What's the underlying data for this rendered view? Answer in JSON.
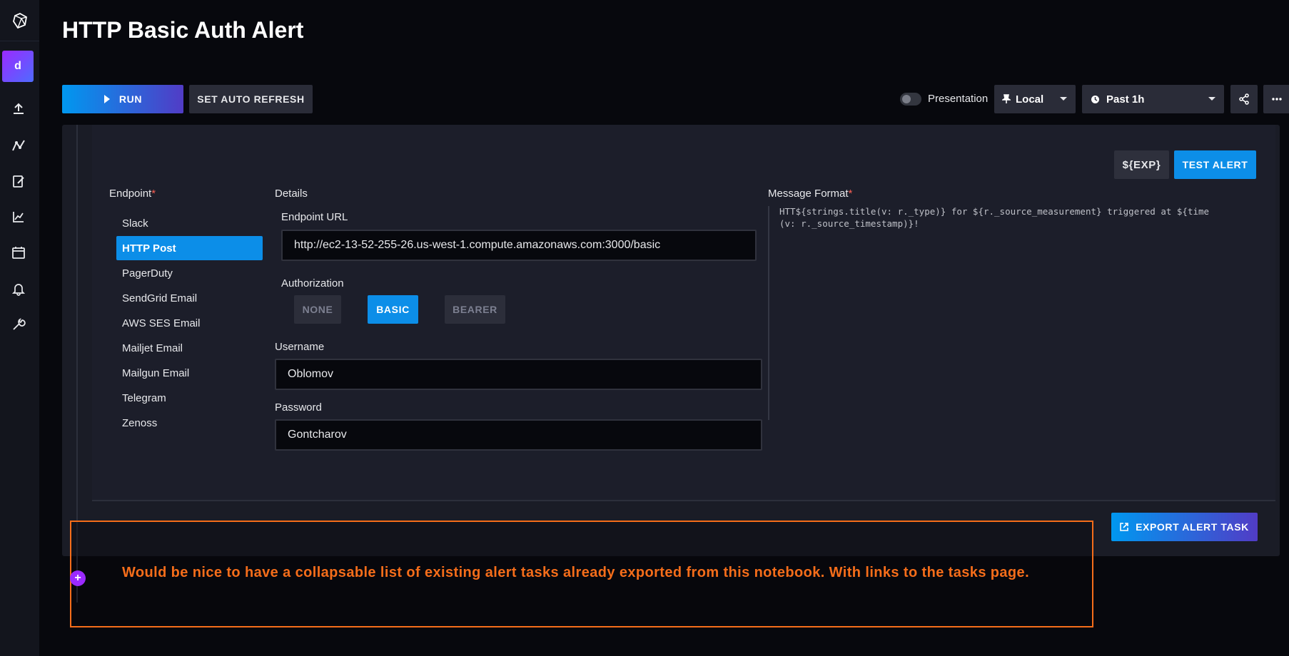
{
  "page": {
    "title": "HTTP Basic Auth Alert"
  },
  "sidebar": {
    "org_initial": "d",
    "icons": [
      "upload-icon",
      "data-explorer-icon",
      "notebook-icon",
      "dashboard-icon",
      "tasks-calendar-icon",
      "alerts-bell-icon",
      "settings-wrench-icon"
    ]
  },
  "toolbar": {
    "run_label": "RUN",
    "auto_refresh_label": "SET AUTO REFRESH",
    "presentation_label": "Presentation",
    "timezone": "Local",
    "time_range": "Past 1h"
  },
  "alert": {
    "exp_label": "${EXP}",
    "test_label": "TEST ALERT",
    "endpoint_heading": "Endpoint",
    "details_heading": "Details",
    "message_heading": "Message Format",
    "required_mark": "*",
    "endpoints": [
      {
        "label": "Slack",
        "active": false
      },
      {
        "label": "HTTP Post",
        "active": true
      },
      {
        "label": "PagerDuty",
        "active": false
      },
      {
        "label": "SendGrid Email",
        "active": false
      },
      {
        "label": "AWS SES Email",
        "active": false
      },
      {
        "label": "Mailjet Email",
        "active": false
      },
      {
        "label": "Mailgun Email",
        "active": false
      },
      {
        "label": "Telegram",
        "active": false
      },
      {
        "label": "Zenoss",
        "active": false
      }
    ],
    "endpoint_url_label": "Endpoint URL",
    "endpoint_url_value": "http://ec2-13-52-255-26.us-west-1.compute.amazonaws.com:3000/basic",
    "authorization_label": "Authorization",
    "auth_options": [
      {
        "label": "NONE",
        "active": false
      },
      {
        "label": "BASIC",
        "active": true
      },
      {
        "label": "BEARER",
        "active": false
      }
    ],
    "username_label": "Username",
    "username_value": "Oblomov",
    "password_label": "Password",
    "password_value": "Gontcharov",
    "message_format": "HTT${strings.title(v: r._type)} for ${r._source_measurement} triggered at ${time\n(v: r._source_timestamp)}!",
    "export_label": "EXPORT ALERT TASK"
  },
  "annotation": {
    "text": "Would be nice to have a collapsable list of existing alert tasks already exported from this notebook. With links to the tasks page.",
    "add_symbol": "+"
  },
  "colors": {
    "accent_blue": "#0c8ee8",
    "accent_purple": "#9b2aff",
    "annotation_orange": "#f56d1a"
  }
}
